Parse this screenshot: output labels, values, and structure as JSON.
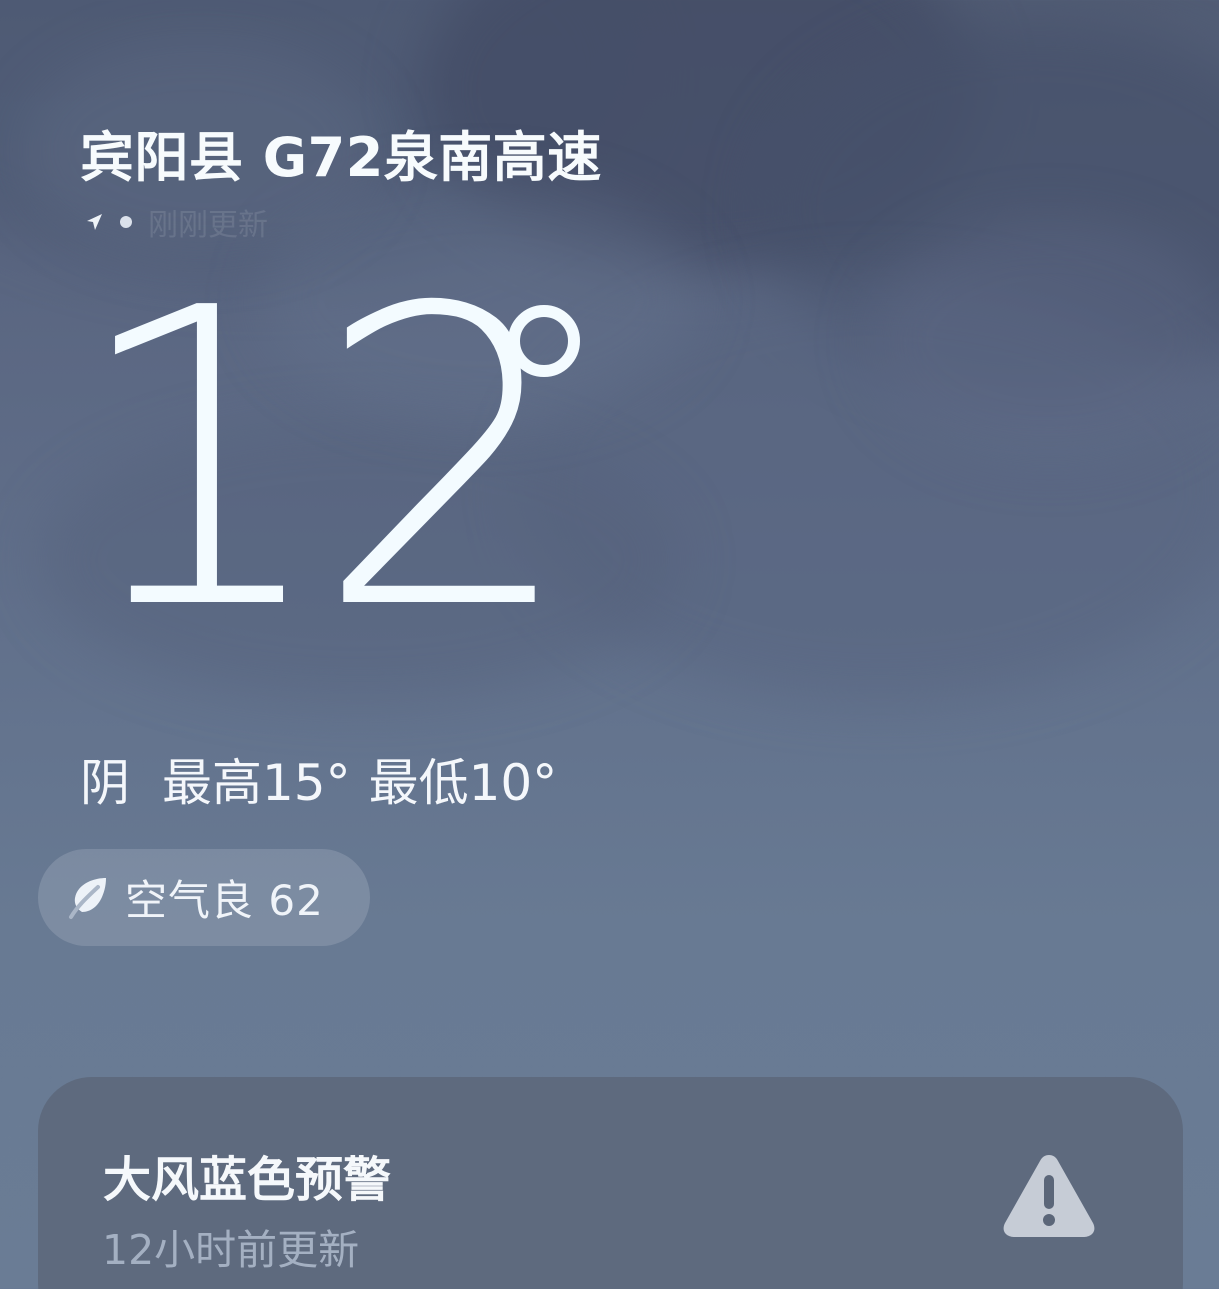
{
  "header": {
    "location_title": "宾阳县 G72泉南高速",
    "update_text": "刚刚更新"
  },
  "current": {
    "temperature": "12",
    "condition": "阴",
    "high_label": "最高15°",
    "low_label": "最低10°"
  },
  "air_quality": {
    "label": "空气良 62"
  },
  "alert": {
    "title": "大风蓝色预警",
    "subtitle": "12小时前更新"
  },
  "icons": {
    "location": "location-arrow-icon",
    "status": "dot-icon",
    "degree": "degree-icon",
    "air": "leaf-icon",
    "warning": "warning-triangle-icon"
  },
  "colors": {
    "text_primary": "#f4f8fb",
    "text_secondary": "#b0bccd",
    "pill_bg": "#c1c9d6",
    "card_bg": "#5b6679"
  }
}
